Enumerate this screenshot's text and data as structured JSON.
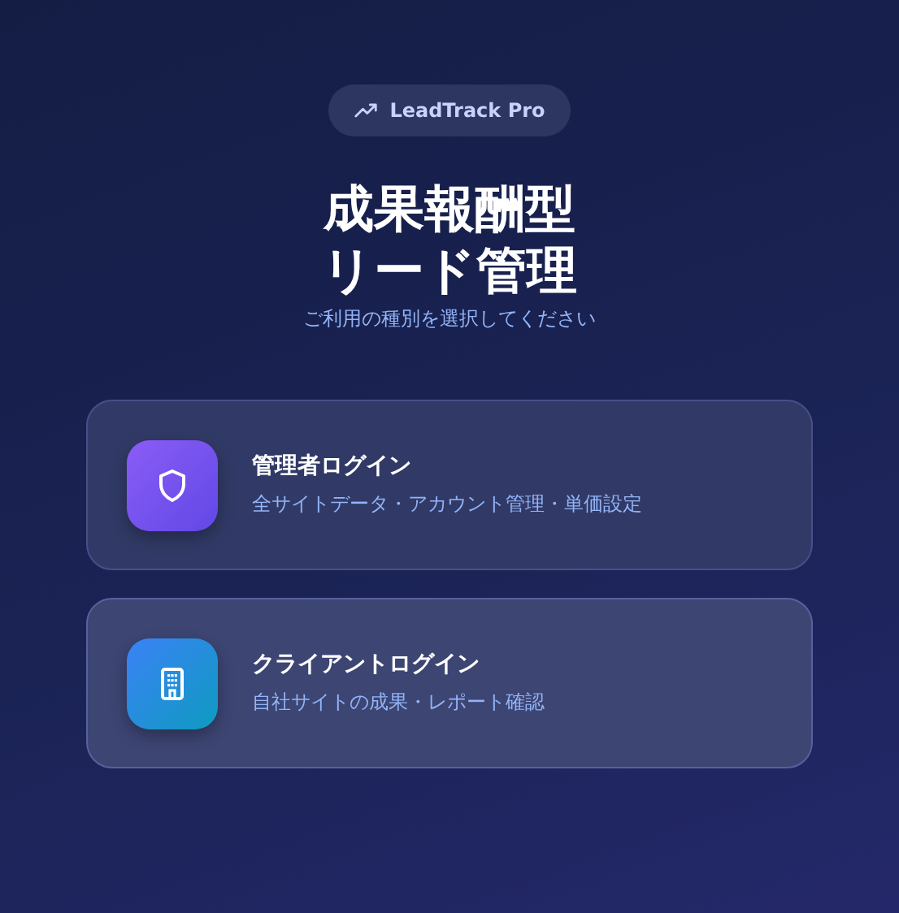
{
  "badge": {
    "label": "LeadTrack Pro"
  },
  "title_lines": [
    "成果報酬型",
    "リード管理"
  ],
  "subtitle": "ご利用の種別を選択してください",
  "options": [
    {
      "kind": "admin",
      "title": "管理者ログイン",
      "description": "全サイトデータ・アカウント管理・単価設定",
      "highlighted": false
    },
    {
      "kind": "client",
      "title": "クライアントログイン",
      "description": "自社サイトの成果・レポート確認",
      "highlighted": true
    }
  ]
}
